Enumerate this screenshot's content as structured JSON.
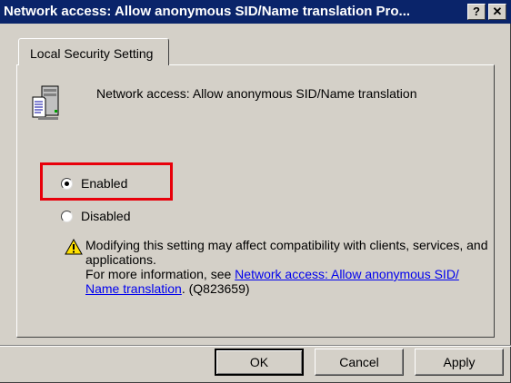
{
  "window": {
    "title": "Network access: Allow anonymous SID/Name translation Pro...",
    "help_button": "?",
    "close_button": "✕"
  },
  "tabs": [
    {
      "label": "Local Security Setting",
      "active": true
    }
  ],
  "policy": {
    "name": "Network access: Allow anonymous SID/Name translation",
    "icon": "policy-server-icon"
  },
  "options": {
    "enabled_label": "Enabled",
    "disabled_label": "Disabled",
    "selected": "Enabled"
  },
  "warning": {
    "icon": "warning-icon",
    "line1": "Modifying this setting may affect compatibility with clients, services, and applications.",
    "more_info_prefix": "For more information, see ",
    "link_text": "Network access: Allow anonymous SID/ Name translation",
    "suffix": ". (Q823659)"
  },
  "buttons": {
    "ok": "OK",
    "cancel": "Cancel",
    "apply": "Apply"
  },
  "colors": {
    "titlebar": "#0a246a",
    "highlight_box": "#e8000b",
    "link": "#0000ee"
  }
}
